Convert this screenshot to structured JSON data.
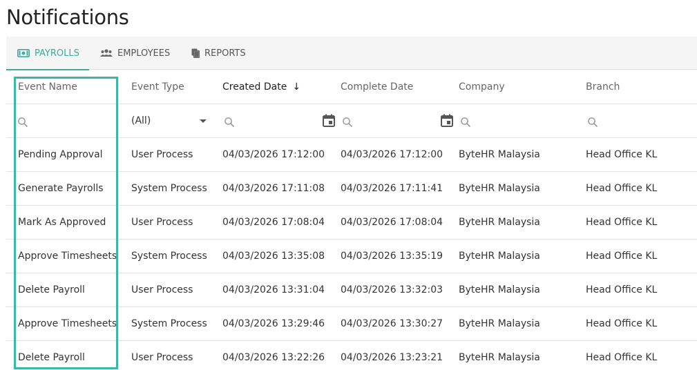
{
  "page": {
    "title": "Notifications"
  },
  "tabs": [
    {
      "label": "PAYROLLS",
      "icon": "money-icon",
      "active": true
    },
    {
      "label": "EMPLOYEES",
      "icon": "users-icon",
      "active": false
    },
    {
      "label": "REPORTS",
      "icon": "copy-icon",
      "active": false
    }
  ],
  "columns": [
    "Event Name",
    "Event Type",
    "Created Date",
    "Complete Date",
    "Company",
    "Branch"
  ],
  "sort": {
    "column": "Created Date",
    "direction": "desc",
    "arrow": "↓"
  },
  "filters": {
    "event_type_value": "(All)"
  },
  "rows": [
    [
      "Pending Approval",
      "User Process",
      "04/03/2026 17:12:00",
      "04/03/2026 17:12:00",
      "ByteHR Malaysia",
      "Head Office KL"
    ],
    [
      "Generate Payrolls",
      "System Process",
      "04/03/2026 17:11:08",
      "04/03/2026 17:11:41",
      "ByteHR Malaysia",
      "Head Office KL"
    ],
    [
      "Mark As Approved",
      "User Process",
      "04/03/2026 17:08:04",
      "04/03/2026 17:08:04",
      "ByteHR Malaysia",
      "Head Office KL"
    ],
    [
      "Approve Timesheets",
      "System Process",
      "04/03/2026 13:35:08",
      "04/03/2026 13:35:19",
      "ByteHR Malaysia",
      "Head Office KL"
    ],
    [
      "Delete Payroll",
      "User Process",
      "04/03/2026 13:31:04",
      "04/03/2026 13:32:03",
      "ByteHR Malaysia",
      "Head Office KL"
    ],
    [
      "Approve Timesheets",
      "System Process",
      "04/03/2026 13:29:46",
      "04/03/2026 13:30:27",
      "ByteHR Malaysia",
      "Head Office KL"
    ],
    [
      "Delete Payroll",
      "User Process",
      "04/03/2026 13:22:26",
      "04/03/2026 13:23:21",
      "ByteHR Malaysia",
      "Head Office KL"
    ]
  ],
  "colors": {
    "accent": "#3aaa9c",
    "highlight": "#3cb8a6"
  }
}
